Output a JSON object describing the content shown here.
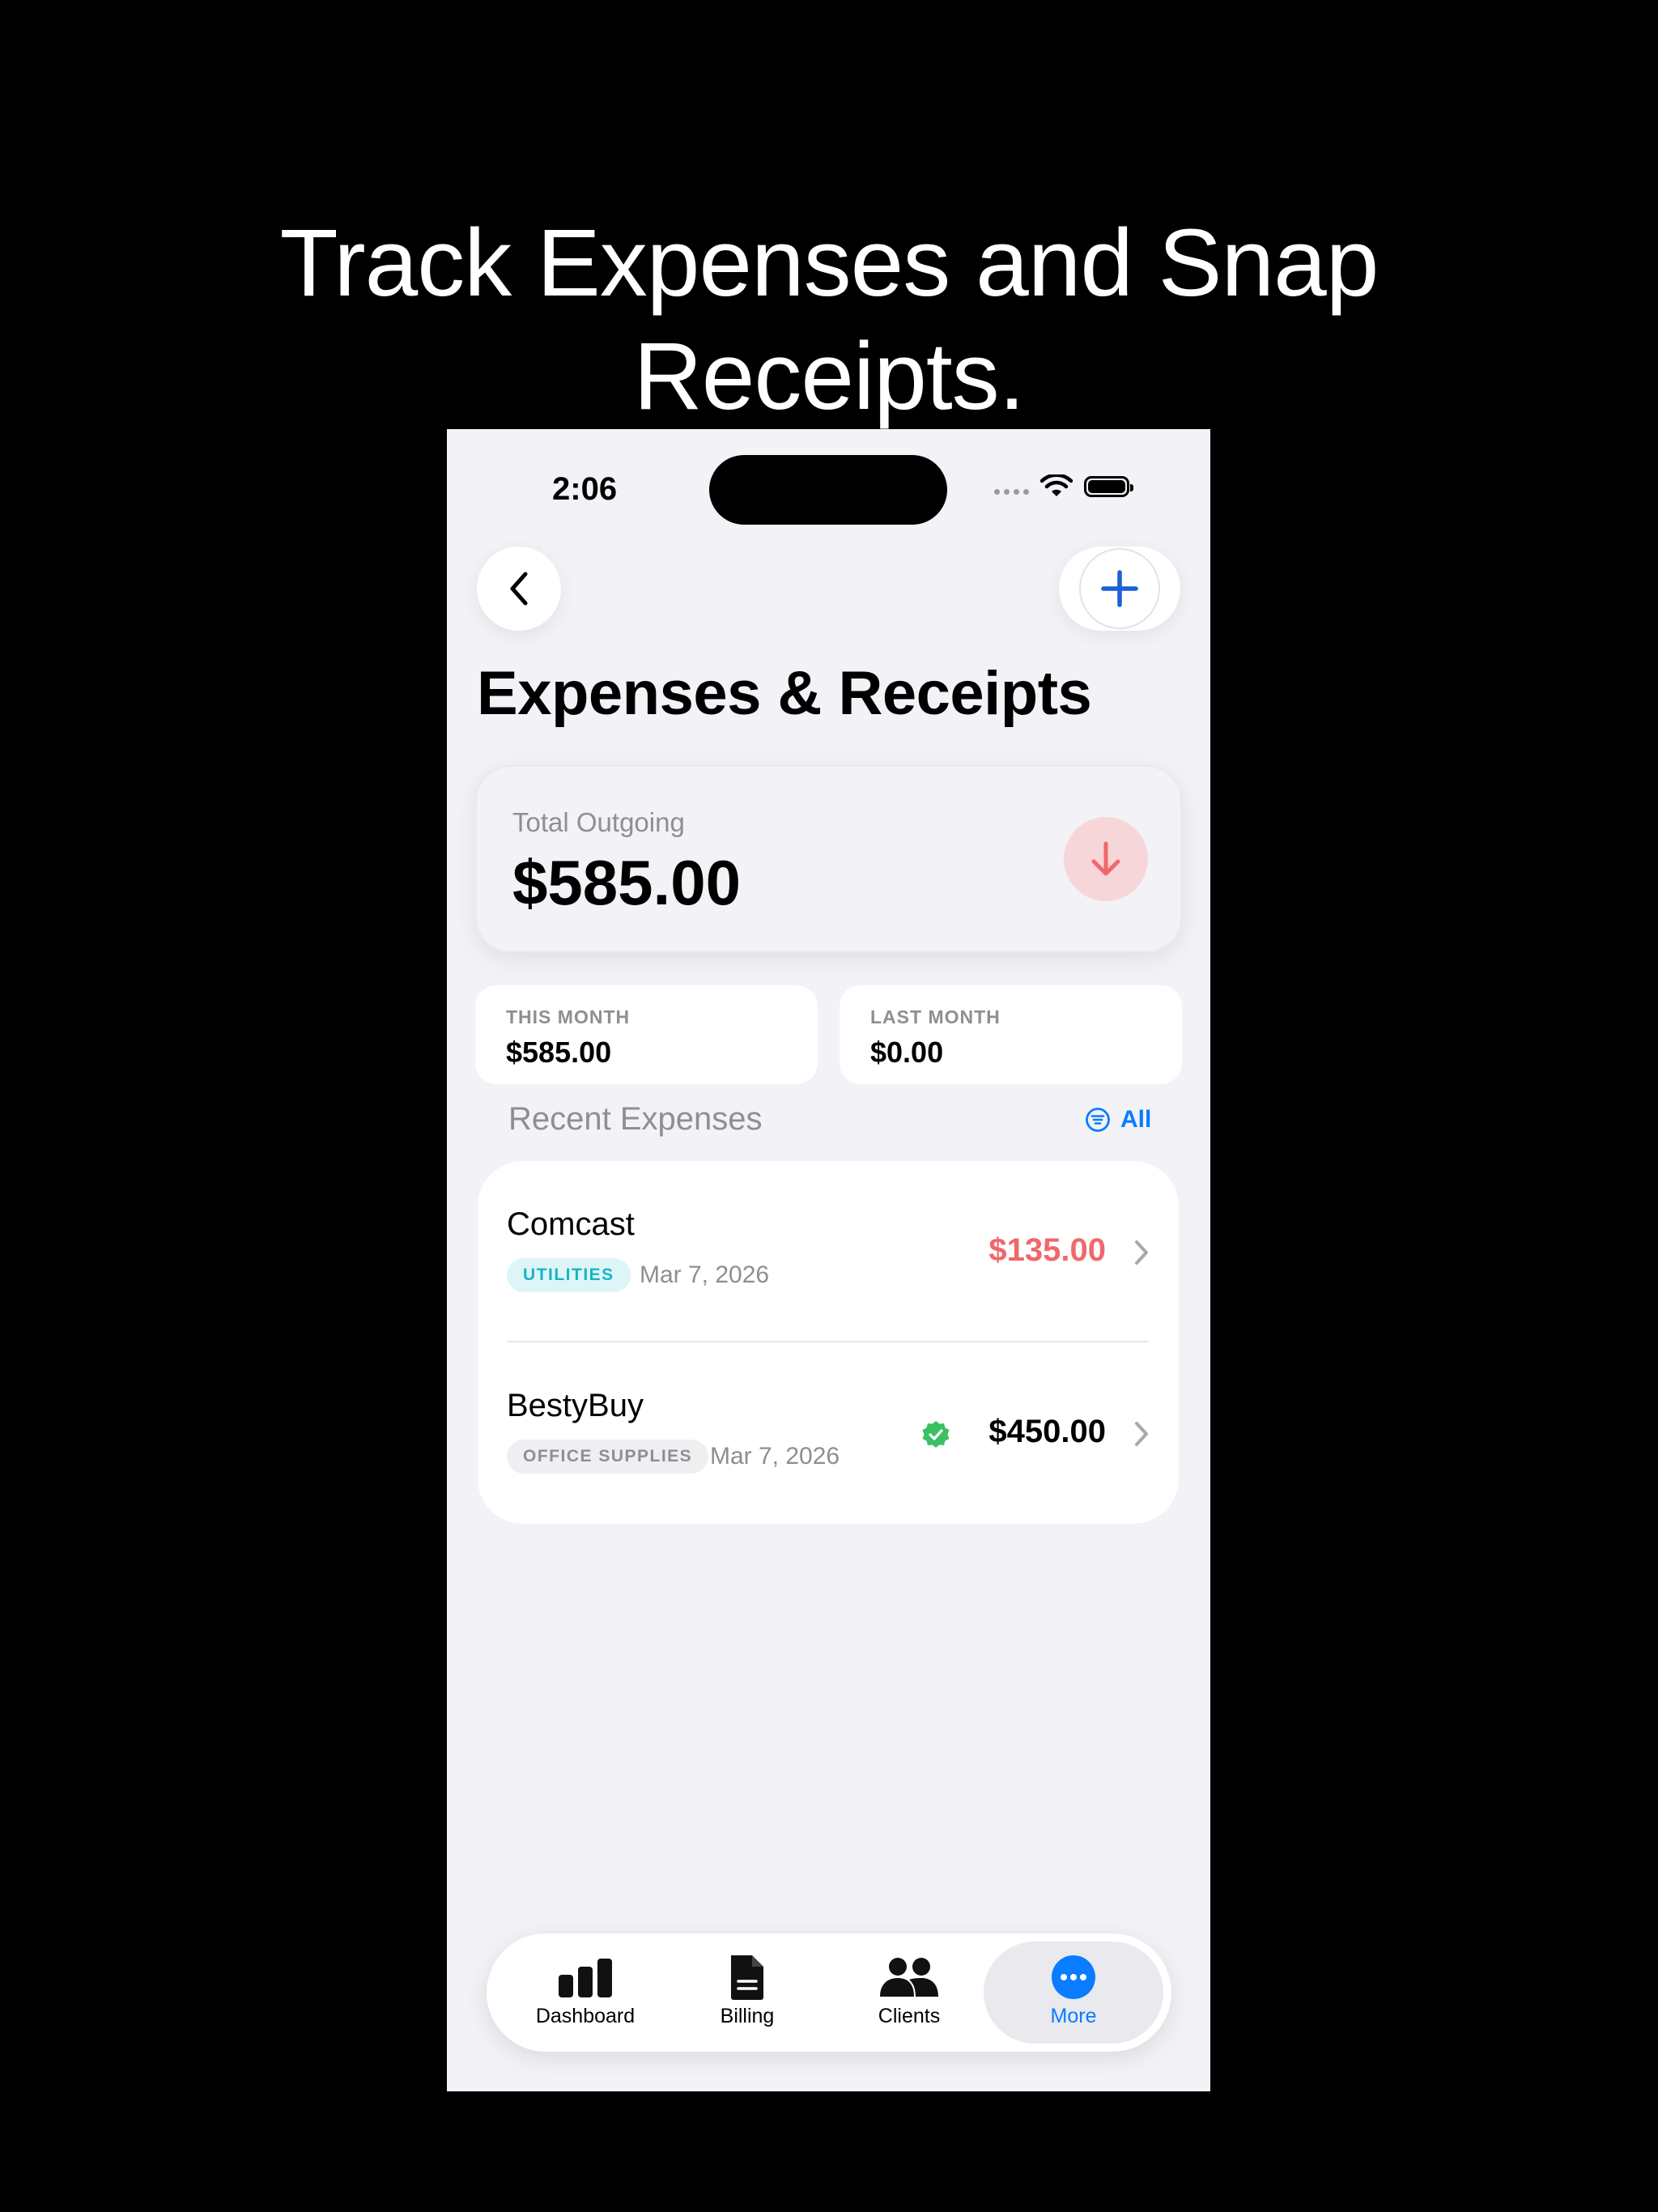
{
  "headline": {
    "line1": "Track Expenses and Snap",
    "line2": "Receipts."
  },
  "status_bar": {
    "time": "2:06"
  },
  "header": {
    "title": "Expenses & Receipts"
  },
  "summary": {
    "label": "Total Outgoing",
    "amount": "$585.00"
  },
  "months": [
    {
      "label": "THIS MONTH",
      "value": "$585.00"
    },
    {
      "label": "LAST MONTH",
      "value": "$0.00"
    }
  ],
  "recent": {
    "title": "Recent Expenses",
    "filter_label": "All",
    "items": [
      {
        "vendor": "Comcast",
        "category": "UTILITIES",
        "date": "Mar 7, 2026",
        "amount": "$135.00",
        "verified": false
      },
      {
        "vendor": "BestyBuy",
        "category": "OFFICE SUPPLIES",
        "date": "Mar 7, 2026",
        "amount": "$450.00",
        "verified": true
      }
    ]
  },
  "tabbar": {
    "tabs": [
      {
        "label": "Dashboard",
        "icon": "chart-bars-icon"
      },
      {
        "label": "Billing",
        "icon": "document-icon"
      },
      {
        "label": "Clients",
        "icon": "people-icon"
      },
      {
        "label": "More",
        "icon": "ellipsis-circle-icon",
        "active": true
      }
    ]
  },
  "colors": {
    "accent": "#0a7cff",
    "expense_red": "#f0686c",
    "utilities_teal": "#17b5c4",
    "verified_green": "#3cc063",
    "background": "#f2f2f7"
  }
}
